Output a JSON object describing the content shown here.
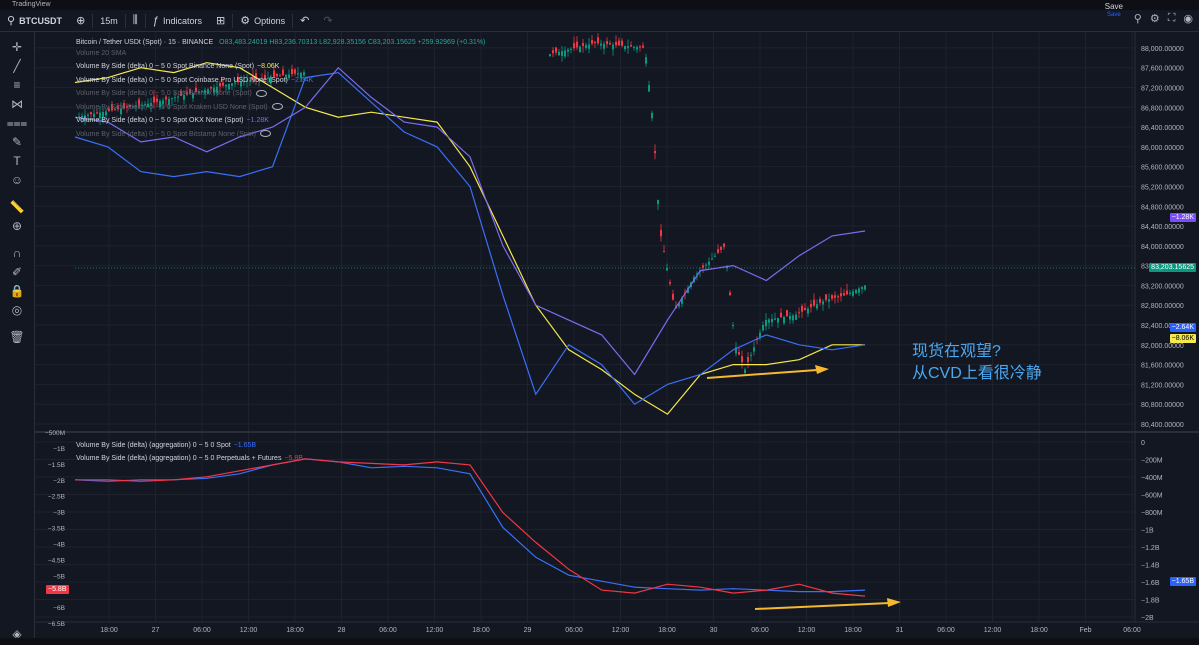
{
  "window": {
    "title": "TradingView"
  },
  "toolbar": {
    "symbol": "BTCUSDT",
    "interval": "15m",
    "indicators_label": "Indicators",
    "options_label": "Options",
    "save_label": "Save",
    "save_sub": "Save"
  },
  "main_legend": {
    "title": "Bitcoin / Tether USDt (Spot) · 15 · BINANCE",
    "ohlc": "O83,483.24019 H83,236.70313 L82,928.35156 C83,203.15625 +259.92969 (+0.31%)",
    "vol_sma": "Volume 20 SMA",
    "rows": [
      {
        "label": "Volume By Side (delta) 0 ~ 5 0 Spot Binance None (Spot)",
        "value": "−8.06K",
        "color": "#f5e94d",
        "dim": false
      },
      {
        "label": "Volume By Side (delta) 0 ~ 5 0 Spot Coinbase Pro USD None (Spot)",
        "value": "−2.64K",
        "color": "#3a6ff7",
        "dim": false
      },
      {
        "label": "Volume By Side (delta) 0 ~ 5 0 Spot Bitfinex None (Spot)",
        "value": "",
        "color": "#5d606b",
        "dim": true
      },
      {
        "label": "Volume By Side (delta) 0 ~ 5 0 Spot Kraken USD None (Spot)",
        "value": "",
        "color": "#5d606b",
        "dim": true
      },
      {
        "label": "Volume By Side (delta) 0 ~ 5 0 Spot OKX None (Spot)",
        "value": "−1.28K",
        "color": "#7c6cf0",
        "dim": false
      },
      {
        "label": "Volume By Side (delta) 0 ~ 5 0 Spot Bitstamp None (Spot)",
        "value": "",
        "color": "#5d606b",
        "dim": true
      }
    ]
  },
  "sub_legend": {
    "rows": [
      {
        "label": "Volume By Side (delta) (aggregation) 0 ~ 5 0 Spot",
        "value": "−1.65B",
        "color": "#3a6ff7"
      },
      {
        "label": "Volume By Side (delta) (aggregation) 0 ~ 5 0 Perpetuals + Futures",
        "value": "−5.8B",
        "color": "#f23645"
      }
    ]
  },
  "annotation": {
    "line1": "现货在观望?",
    "line2": "从CVD上看很冷静"
  },
  "price_axis": [
    "88,000.00000",
    "87,600.00000",
    "87,200.00000",
    "86,800.00000",
    "86,400.00000",
    "86,000.00000",
    "85,600.00000",
    "85,200.00000",
    "84,800.00000",
    "84,400.00000",
    "84,000.00000",
    "83,600.00000",
    "83,200.00000",
    "82,800.00000",
    "82,400.00000",
    "82,000.00000",
    "81,600.00000",
    "81,200.00000",
    "80,800.00000",
    "80,400.00000"
  ],
  "price_badges": [
    {
      "text": "−1.28K",
      "color": "#7c4dff"
    },
    {
      "text": "83,203.15625",
      "color": "#089981"
    },
    {
      "text": "−2.64K",
      "color": "#2962ff"
    },
    {
      "text": "−8.06K",
      "color": "#f5e94d"
    }
  ],
  "sub_axis_right": [
    "0",
    "−200M",
    "−400M",
    "−600M",
    "−800M",
    "−1B",
    "−1.2B",
    "−1.4B",
    "−1.6B",
    "−1.8B",
    "−2B"
  ],
  "sub_axis_right_badge": "−1.65B",
  "sub_axis_left": [
    "−500M",
    "−1B",
    "−1.5B",
    "−2B",
    "−2.5B",
    "−3B",
    "−3.5B",
    "−4B",
    "−4.5B",
    "−5B",
    "−5.5B",
    "−6B",
    "−6.5B"
  ],
  "sub_axis_left_badge": "−5.8B",
  "time_axis": [
    "18:00",
    "27",
    "06:00",
    "12:00",
    "18:00",
    "28",
    "06:00",
    "12:00",
    "18:00",
    "29",
    "06:00",
    "12:00",
    "18:00",
    "30",
    "06:00",
    "12:00",
    "18:00",
    "31",
    "06:00",
    "12:00",
    "18:00",
    "Feb",
    "06:00"
  ],
  "chart_data": {
    "type": "line",
    "title": "Bitcoin / Tether USDt (Spot) · 15 · BINANCE",
    "price_last": 83203.15625,
    "price_range": [
      80400,
      88200
    ],
    "main_series": [
      {
        "name": "Binance",
        "color": "#f5e94d",
        "values": [
          87.3,
          87.4,
          87.6,
          87.5,
          87.7,
          87.6,
          87.2,
          86.8,
          86.6,
          86.7,
          86.6,
          86.5,
          85.6,
          84.2,
          82.8,
          81.9,
          81.5,
          81.0,
          80.6,
          81.4,
          81.6,
          81.6,
          81.7,
          82.0,
          82.0
        ]
      },
      {
        "name": "Coinbase Pro USD",
        "color": "#3a6ff7",
        "values": [
          86.2,
          86.0,
          85.5,
          85.4,
          85.5,
          85.4,
          85.6,
          87.4,
          87.5,
          86.9,
          86.3,
          86.0,
          85.2,
          83.0,
          81.0,
          82.0,
          81.6,
          80.8,
          81.2,
          81.4,
          81.9,
          82.2,
          82.0,
          81.9,
          82.0
        ]
      },
      {
        "name": "OKX",
        "color": "#7c6cf0",
        "values": [
          86.6,
          86.5,
          86.1,
          86.2,
          85.9,
          86.2,
          86.4,
          86.8,
          87.6,
          87.0,
          86.5,
          86.4,
          85.8,
          84.0,
          82.8,
          82.5,
          82.2,
          81.4,
          82.5,
          83.5,
          83.6,
          83.3,
          83.8,
          84.2,
          84.3
        ]
      }
    ],
    "sub_series": [
      {
        "name": "Spot",
        "color": "#3a6ff7",
        "values": [
          -1.9,
          -1.95,
          -1.9,
          -1.9,
          -1.85,
          -1.7,
          -1.4,
          -1.2,
          -1.3,
          -1.5,
          -1.45,
          -1.5,
          -1.7,
          -3.5,
          -4.5,
          -5.1,
          -5.3,
          -5.5,
          -5.55,
          -5.6,
          -5.55,
          -5.6,
          -5.65,
          -5.65,
          -5.6
        ]
      },
      {
        "name": "Perpetuals + Futures",
        "color": "#f23645",
        "values": [
          -1.9,
          -1.9,
          -1.95,
          -1.9,
          -1.8,
          -1.6,
          -1.4,
          -1.2,
          -1.3,
          -1.35,
          -1.4,
          -1.3,
          -1.4,
          -3.0,
          -4.0,
          -4.9,
          -5.6,
          -5.7,
          -5.4,
          -5.5,
          -5.7,
          -5.6,
          -5.4,
          -5.7,
          -5.8
        ]
      }
    ],
    "sub_range": [
      -6.5,
      -0.5
    ]
  }
}
